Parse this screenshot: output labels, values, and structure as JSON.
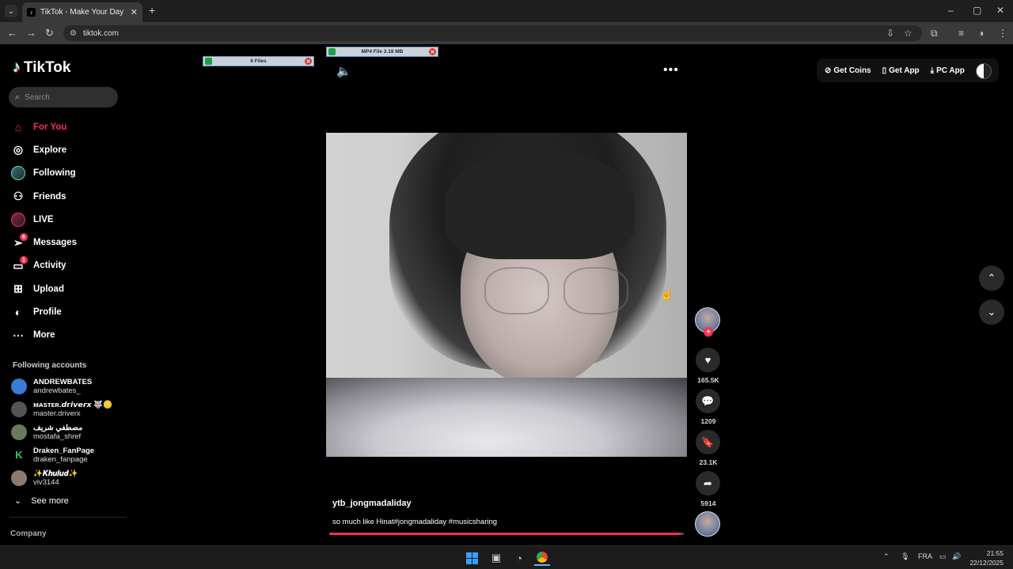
{
  "browser": {
    "tab_title": "TikTok - Make Your Day",
    "new_tab": "+",
    "url": "tiktok.com",
    "window_controls": [
      "–",
      "▢",
      "✕"
    ]
  },
  "downloads": {
    "pill1": "6 Files",
    "pill2": "MP4 File 3.18 MB"
  },
  "sidebar": {
    "logo": "TikTok",
    "search_placeholder": "Search",
    "nav": [
      {
        "label": "For You",
        "icon": "home-icon"
      },
      {
        "label": "Explore",
        "icon": "compass-icon"
      },
      {
        "label": "Following",
        "icon": "following-avatar-icon"
      },
      {
        "label": "Friends",
        "icon": "friends-icon"
      },
      {
        "label": "LIVE",
        "icon": "live-icon"
      },
      {
        "label": "Messages",
        "icon": "messages-icon",
        "badge": "6"
      },
      {
        "label": "Activity",
        "icon": "activity-icon",
        "badge": "1"
      },
      {
        "label": "Upload",
        "icon": "upload-icon"
      },
      {
        "label": "Profile",
        "icon": "profile-icon"
      },
      {
        "label": "More",
        "icon": "more-icon"
      }
    ],
    "following_heading": "Following accounts",
    "accounts": [
      {
        "name": "ANDREWBATES",
        "handle": "andrewbates_",
        "color": "#3a7bd5"
      },
      {
        "name": "ᴍᴀsᴛᴇʀ.𝙙𝙧𝙞𝙫𝙚𝙧𝙭 🐺🪙",
        "handle": "master.driverx",
        "color": "#555555"
      },
      {
        "name": "مصطفي شريف",
        "handle": "mostafa_shref",
        "color": "#6a7a5a"
      },
      {
        "name": "Draken_FanPage",
        "handle": "draken_fanpage",
        "color": "#000000"
      },
      {
        "name": "✨𝑲𝒉𝒖𝒍𝒖𝒅✨",
        "handle": "viv3144",
        "color": "#8a7a70"
      }
    ],
    "see_more": "See more",
    "company": "Company"
  },
  "video": {
    "username": "ytb_jongmadaliday",
    "description": "so much like Hinat#jongmadaliday #musicsharing",
    "progress": 0.99
  },
  "actions": {
    "likes": "165.5K",
    "comments": "1209",
    "saves": "23.1K",
    "shares": "5914"
  },
  "header": {
    "get_coins": "Get Coins",
    "get_app": "Get App",
    "pc_app": "PC App"
  },
  "taskbar": {
    "lang": "FRA",
    "time": "21:55",
    "date": "22/12/2025"
  },
  "colors": {
    "accent": "#fe2c55",
    "background": "#000000"
  }
}
